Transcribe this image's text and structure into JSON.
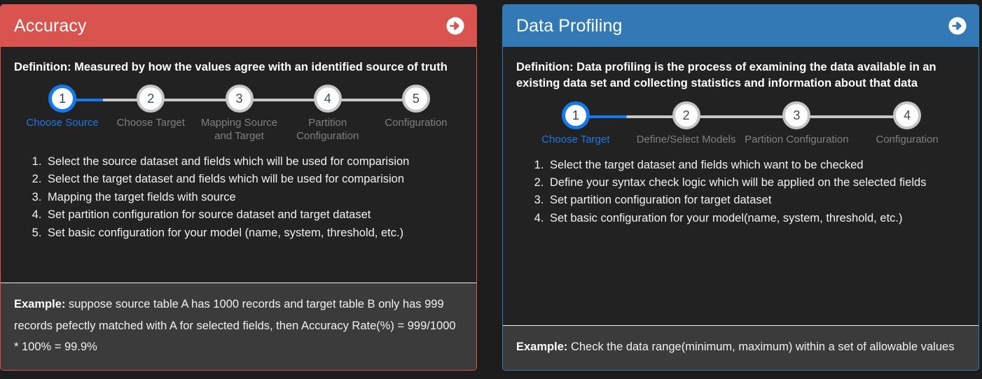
{
  "cards": [
    {
      "title": "Accuracy",
      "accent": "#d9534f",
      "header_icon": "arrow-circle-right-icon",
      "definition": "Definition: Measured by how the values agree with an identified source of truth",
      "stepper": [
        {
          "number": "1",
          "label": "Choose Source",
          "active": true
        },
        {
          "number": "2",
          "label": "Choose Target",
          "active": false
        },
        {
          "number": "3",
          "label": "Mapping Source and Target",
          "active": false
        },
        {
          "number": "4",
          "label": "Partition Configuration",
          "active": false
        },
        {
          "number": "5",
          "label": "Configuration",
          "active": false
        }
      ],
      "list": [
        "Select the source dataset and fields which will be used for comparision",
        "Select the target dataset and fields which will be used for comparision",
        "Mapping the target fields with source",
        "Set partition configuration for source dataset and target dataset",
        "Set basic configuration for your model (name, system, threshold, etc.)"
      ],
      "example_label": "Example:",
      "example_text": " suppose source table A has 1000 records and target table B only has 999 records pefectly matched with A for selected fields, then Accuracy Rate(%) = 999/1000 * 100% = 99.9%"
    },
    {
      "title": "Data Profiling",
      "accent": "#3379b5",
      "header_icon": "arrow-circle-right-icon",
      "definition": "Definition: Data profiling is the process of examining the data available in an existing data set and collecting statistics and information about that data",
      "stepper": [
        {
          "number": "1",
          "label": "Choose Target",
          "active": true
        },
        {
          "number": "2",
          "label": "Define/Select Models",
          "active": false
        },
        {
          "number": "3",
          "label": "Partition Configuration",
          "active": false
        },
        {
          "number": "4",
          "label": "Configuration",
          "active": false
        }
      ],
      "list": [
        "Select the target dataset and fields which want to be checked",
        "Define your syntax check logic which will be applied on the selected fields",
        "Set partition configuration for target dataset",
        "Set basic configuration for your model(name, system, threshold, etc.)"
      ],
      "example_label": "Example:",
      "example_text": " Check the data range(minimum, maximum) within a set of allowable values"
    }
  ],
  "colors": {
    "page_background": "#1d1d1d",
    "card_background": "#222222",
    "footer_background": "#3b3b3b",
    "accent_red": "#d9534f",
    "accent_blue": "#3379b5",
    "step_active": "#1479ef",
    "step_inactive": "#c6c6c6"
  }
}
